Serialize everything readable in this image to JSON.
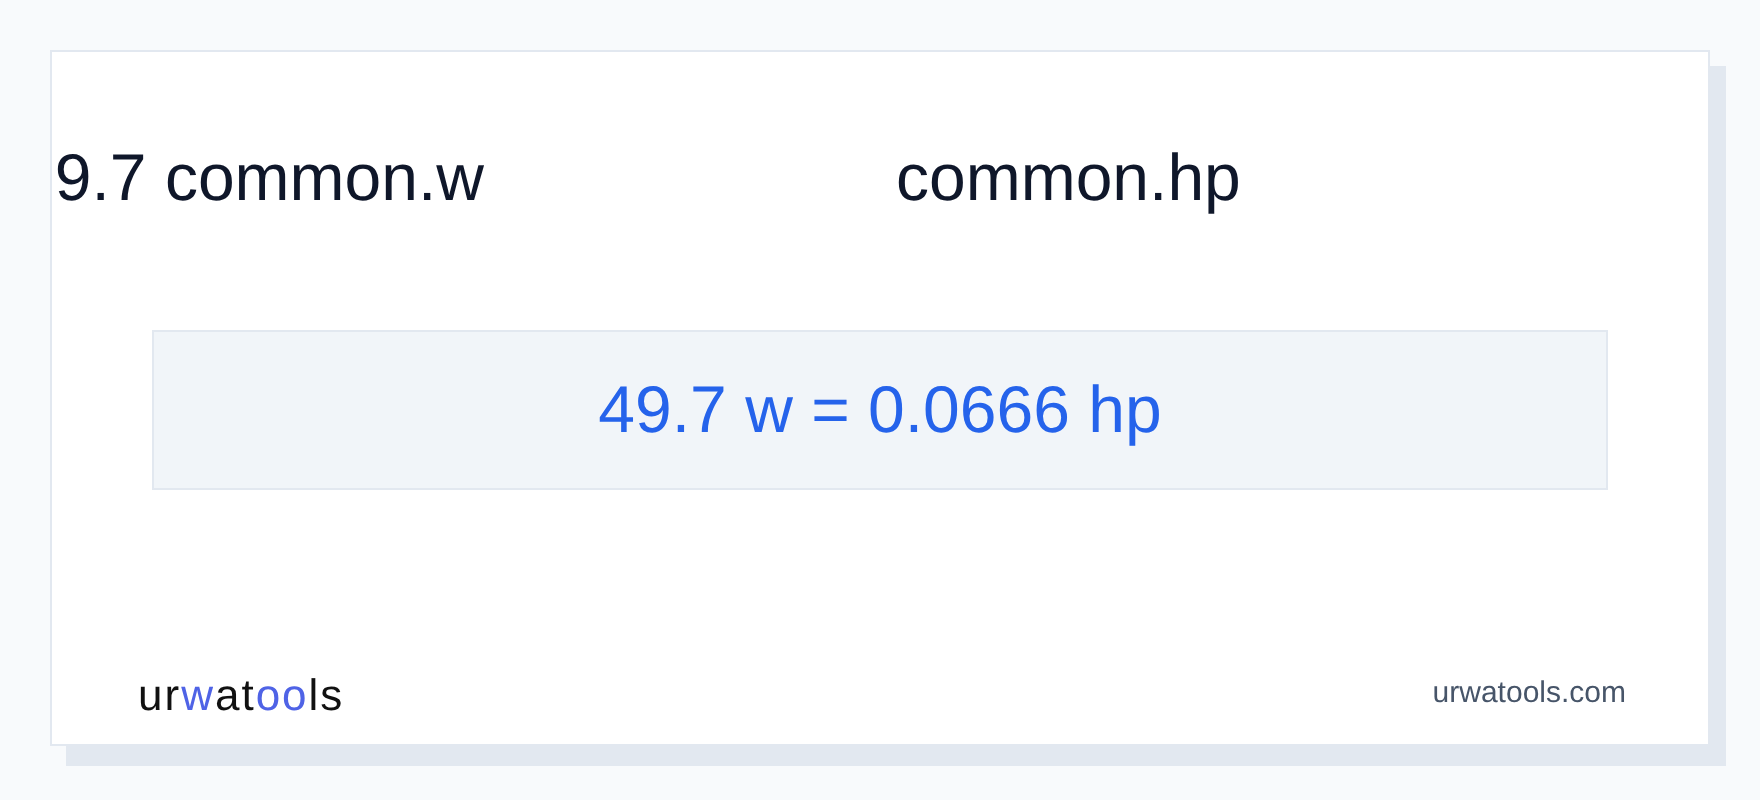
{
  "from_unit": "9.7 common.w",
  "to_unit": "common.hp",
  "result": "49.7 w = 0.0666 hp",
  "logo": {
    "parts": [
      {
        "text": "ur",
        "accent": false
      },
      {
        "text": "w",
        "accent": true
      },
      {
        "text": "at",
        "accent": false
      },
      {
        "text": "oo",
        "accent": true
      },
      {
        "text": "ls",
        "accent": false
      }
    ]
  },
  "site": "urwatools.com"
}
